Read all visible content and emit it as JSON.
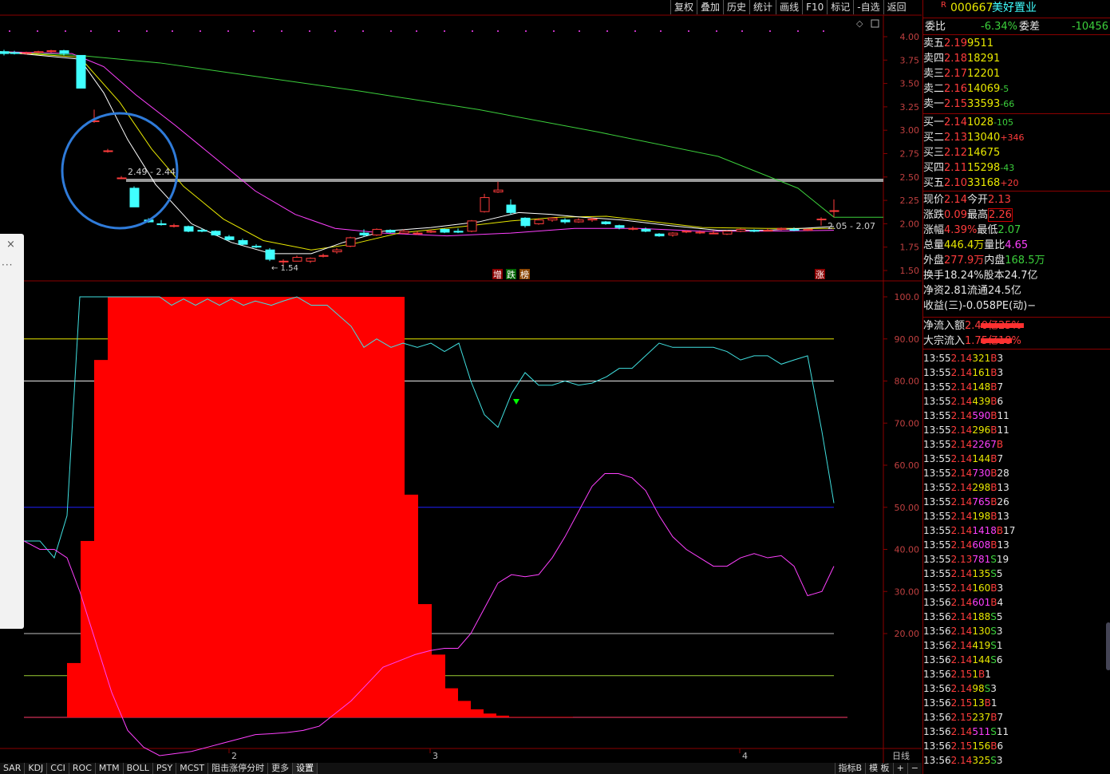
{
  "toolbar": {
    "items": [
      "复权",
      "叠加",
      "历史",
      "统计",
      "画线",
      "F10",
      "标记",
      "-自选",
      "返回"
    ]
  },
  "stock": {
    "flag": "R",
    "code": "000667",
    "name": "美好置业"
  },
  "price_axis": [
    "4.00",
    "3.75",
    "3.50",
    "3.25",
    "3.00",
    "2.75",
    "2.50",
    "2.25",
    "2.00",
    "1.75",
    "1.50"
  ],
  "indicator_axis": [
    "100.0",
    "90.00",
    "80.00",
    "70.00",
    "60.00",
    "50.00",
    "40.00",
    "30.00",
    "20.00"
  ],
  "annotations": {
    "range_label": "2.49 - 2.44",
    "right_range_label": "2.05 - 2.07",
    "low_label": "1.54",
    "tag_increase": "增",
    "tag_drop": "跌",
    "tag_list": "榜",
    "tag_rise": "涨"
  },
  "date_axis": {
    "labels": [
      "2",
      "3",
      "4"
    ],
    "period": "日线"
  },
  "bottom_tabs": [
    "SAR",
    "KDJ",
    "CCI",
    "ROC",
    "MTM",
    "BOLL",
    "PSY",
    "MCST",
    "阻击涨停分时",
    "更多",
    "设置"
  ],
  "bottom_right": [
    "指标B",
    "模 板",
    "+",
    "−"
  ],
  "quote": {
    "ratio_label": "委比",
    "ratio_value": "-6.34%",
    "diff_label": "委差",
    "diff_value": "-10456",
    "asks": [
      {
        "label": "卖五",
        "price": "2.19",
        "vol": "9511",
        "chg": ""
      },
      {
        "label": "卖四",
        "price": "2.18",
        "vol": "18291",
        "chg": ""
      },
      {
        "label": "卖三",
        "price": "2.17",
        "vol": "12201",
        "chg": ""
      },
      {
        "label": "卖二",
        "price": "2.16",
        "vol": "14069",
        "chg": "-5"
      },
      {
        "label": "卖一",
        "price": "2.15",
        "vol": "33593",
        "chg": "-66"
      }
    ],
    "bids": [
      {
        "label": "买一",
        "price": "2.14",
        "vol": "1028",
        "chg": "-105"
      },
      {
        "label": "买二",
        "price": "2.13",
        "vol": "13040",
        "chg": "+346"
      },
      {
        "label": "买三",
        "price": "2.12",
        "vol": "14675",
        "chg": ""
      },
      {
        "label": "买四",
        "price": "2.11",
        "vol": "15298",
        "chg": "-43"
      },
      {
        "label": "买五",
        "price": "2.10",
        "vol": "33168",
        "chg": "+20"
      }
    ],
    "stats": [
      {
        "l1": "现价",
        "v1": "2.14",
        "l2": "今开",
        "v2": "2.13"
      },
      {
        "l1": "涨跌",
        "v1": "0.09",
        "l2": "最高",
        "v2": "2.26"
      },
      {
        "l1": "涨幅",
        "v1": "4.39%",
        "l2": "最低",
        "v2": "2.07"
      },
      {
        "l1": "总量",
        "v1": "446.4万",
        "l2": "量比",
        "v2": "4.65"
      },
      {
        "l1": "外盘",
        "v1": "277.9万",
        "l2": "内盘",
        "v2": "168.5万"
      },
      {
        "l1": "换手",
        "v1": "18.24%",
        "l2": "股本",
        "v2": "24.7亿"
      },
      {
        "l1": "净资",
        "v1": "2.81",
        "l2": "流通",
        "v2": "24.5亿"
      },
      {
        "l1": "收益(三)",
        "v1": "-0.058",
        "l2": "PE(动)",
        "v2": "−"
      }
    ],
    "flows": [
      {
        "label": "净流入额",
        "value": "2.40亿",
        "pct": "25%",
        "fill": 0.9
      },
      {
        "label": "大宗流入",
        "value": "1.75亿",
        "pct": "18%",
        "fill": 0.65
      }
    ],
    "ticks": [
      {
        "t": "13:55",
        "p": "2.14",
        "v": "321",
        "s": "B",
        "n": "3"
      },
      {
        "t": "13:55",
        "p": "2.14",
        "v": "161",
        "s": "B",
        "n": "3"
      },
      {
        "t": "13:55",
        "p": "2.14",
        "v": "148",
        "s": "B",
        "n": "7"
      },
      {
        "t": "13:55",
        "p": "2.14",
        "v": "439",
        "s": "B",
        "n": "6"
      },
      {
        "t": "13:55",
        "p": "2.14",
        "v": "590",
        "s": "B",
        "n": "11"
      },
      {
        "t": "13:55",
        "p": "2.14",
        "v": "296",
        "s": "B",
        "n": "11"
      },
      {
        "t": "13:55",
        "p": "2.14",
        "v": "2267",
        "s": "B",
        "n": ""
      },
      {
        "t": "13:55",
        "p": "2.14",
        "v": "144",
        "s": "B",
        "n": "7"
      },
      {
        "t": "13:55",
        "p": "2.14",
        "v": "730",
        "s": "B",
        "n": "28"
      },
      {
        "t": "13:55",
        "p": "2.14",
        "v": "298",
        "s": "B",
        "n": "13"
      },
      {
        "t": "13:55",
        "p": "2.14",
        "v": "765",
        "s": "B",
        "n": "26"
      },
      {
        "t": "13:55",
        "p": "2.14",
        "v": "198",
        "s": "B",
        "n": "13"
      },
      {
        "t": "13:55",
        "p": "2.14",
        "v": "1418",
        "s": "B",
        "n": "17"
      },
      {
        "t": "13:55",
        "p": "2.14",
        "v": "608",
        "s": "B",
        "n": "13"
      },
      {
        "t": "13:55",
        "p": "2.13",
        "v": "781",
        "s": "S",
        "n": "19"
      },
      {
        "t": "13:55",
        "p": "2.14",
        "v": "135",
        "s": "S",
        "n": "5"
      },
      {
        "t": "13:55",
        "p": "2.14",
        "v": "160",
        "s": "B",
        "n": "3"
      },
      {
        "t": "13:56",
        "p": "2.14",
        "v": "601",
        "s": "B",
        "n": "4"
      },
      {
        "t": "13:56",
        "p": "2.14",
        "v": "188",
        "s": "S",
        "n": "5"
      },
      {
        "t": "13:56",
        "p": "2.14",
        "v": "130",
        "s": "S",
        "n": "3"
      },
      {
        "t": "13:56",
        "p": "2.14",
        "v": "419",
        "s": "S",
        "n": "1"
      },
      {
        "t": "13:56",
        "p": "2.14",
        "v": "144",
        "s": "S",
        "n": "6"
      },
      {
        "t": "13:56",
        "p": "2.15",
        "v": "1",
        "s": "B",
        "n": "1"
      },
      {
        "t": "13:56",
        "p": "2.14",
        "v": "98",
        "s": "S",
        "n": "3"
      },
      {
        "t": "13:56",
        "p": "2.15",
        "v": "13",
        "s": "B",
        "n": "1"
      },
      {
        "t": "13:56",
        "p": "2.15",
        "v": "237",
        "s": "B",
        "n": "7"
      },
      {
        "t": "13:56",
        "p": "2.14",
        "v": "511",
        "s": "S",
        "n": "11"
      },
      {
        "t": "13:56",
        "p": "2.15",
        "v": "156",
        "s": "B",
        "n": "6"
      },
      {
        "t": "13:56",
        "p": "2.14",
        "v": "325",
        "s": "S",
        "n": "3"
      }
    ]
  },
  "colors": {
    "up": "#ff3c3c",
    "down": "#40ffff",
    "ma5": "#ffffff",
    "ma10": "#e8e800",
    "ma20": "#ff40ff",
    "ma60": "#3cd03c",
    "bar": "#ff0000"
  }
}
